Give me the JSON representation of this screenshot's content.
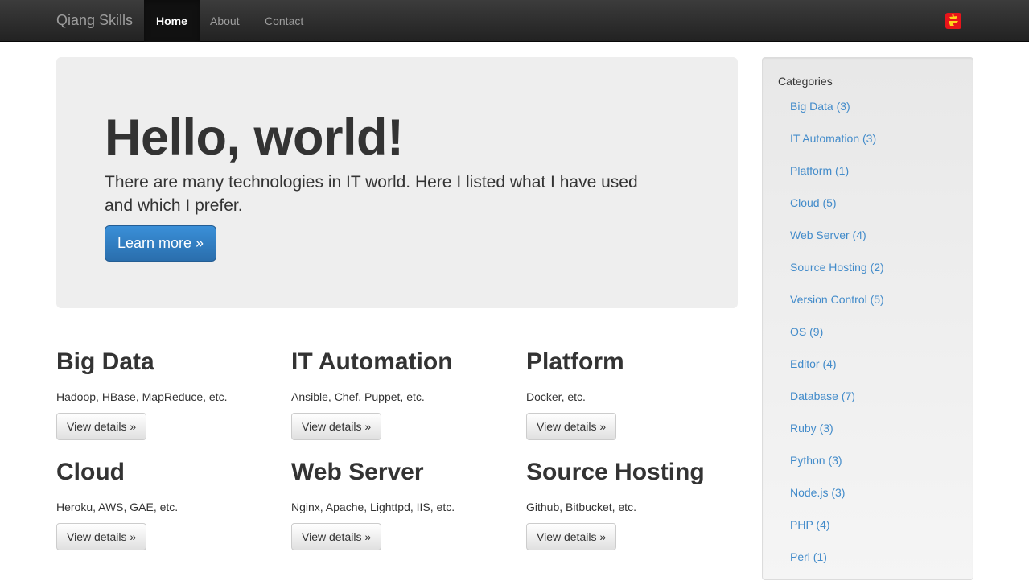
{
  "navbar": {
    "brand": "Qiang Skills",
    "items": [
      {
        "label": "Home",
        "active": true
      },
      {
        "label": "About",
        "active": false
      },
      {
        "label": "Contact",
        "active": false
      }
    ],
    "logo_icon": "red-seal-logo-icon"
  },
  "jumbotron": {
    "title": "Hello, world!",
    "text": "There are many technologies in IT world. Here I listed what I have used and which I prefer.",
    "button_label": "Learn more »"
  },
  "features": [
    {
      "title": "Big Data",
      "description": "Hadoop, HBase, MapReduce, etc.",
      "button_label": "View details »"
    },
    {
      "title": "IT Automation",
      "description": "Ansible, Chef, Puppet, etc.",
      "button_label": "View details »"
    },
    {
      "title": "Platform",
      "description": "Docker, etc.",
      "button_label": "View details »"
    },
    {
      "title": "Cloud",
      "description": "Heroku, AWS, GAE, etc.",
      "button_label": "View details »"
    },
    {
      "title": "Web Server",
      "description": "Nginx, Apache, Lighttpd, IIS, etc.",
      "button_label": "View details »"
    },
    {
      "title": "Source Hosting",
      "description": "Github, Bitbucket, etc.",
      "button_label": "View details »"
    }
  ],
  "sidebar": {
    "title": "Categories",
    "items": [
      {
        "label": "Big Data (3)"
      },
      {
        "label": "IT Automation (3)"
      },
      {
        "label": "Platform (1)"
      },
      {
        "label": "Cloud (5)"
      },
      {
        "label": "Web Server (4)"
      },
      {
        "label": "Source Hosting (2)"
      },
      {
        "label": "Version Control (5)"
      },
      {
        "label": "OS (9)"
      },
      {
        "label": "Editor (4)"
      },
      {
        "label": "Database (7)"
      },
      {
        "label": "Ruby (3)"
      },
      {
        "label": "Python (3)"
      },
      {
        "label": "Node.js (3)"
      },
      {
        "label": "PHP (4)"
      },
      {
        "label": "Perl (1)"
      }
    ]
  },
  "colors": {
    "navbar_bg": "#222222",
    "link": "#428bca",
    "primary_button": "#2a6ead",
    "jumbotron_bg": "#eeeeee"
  }
}
